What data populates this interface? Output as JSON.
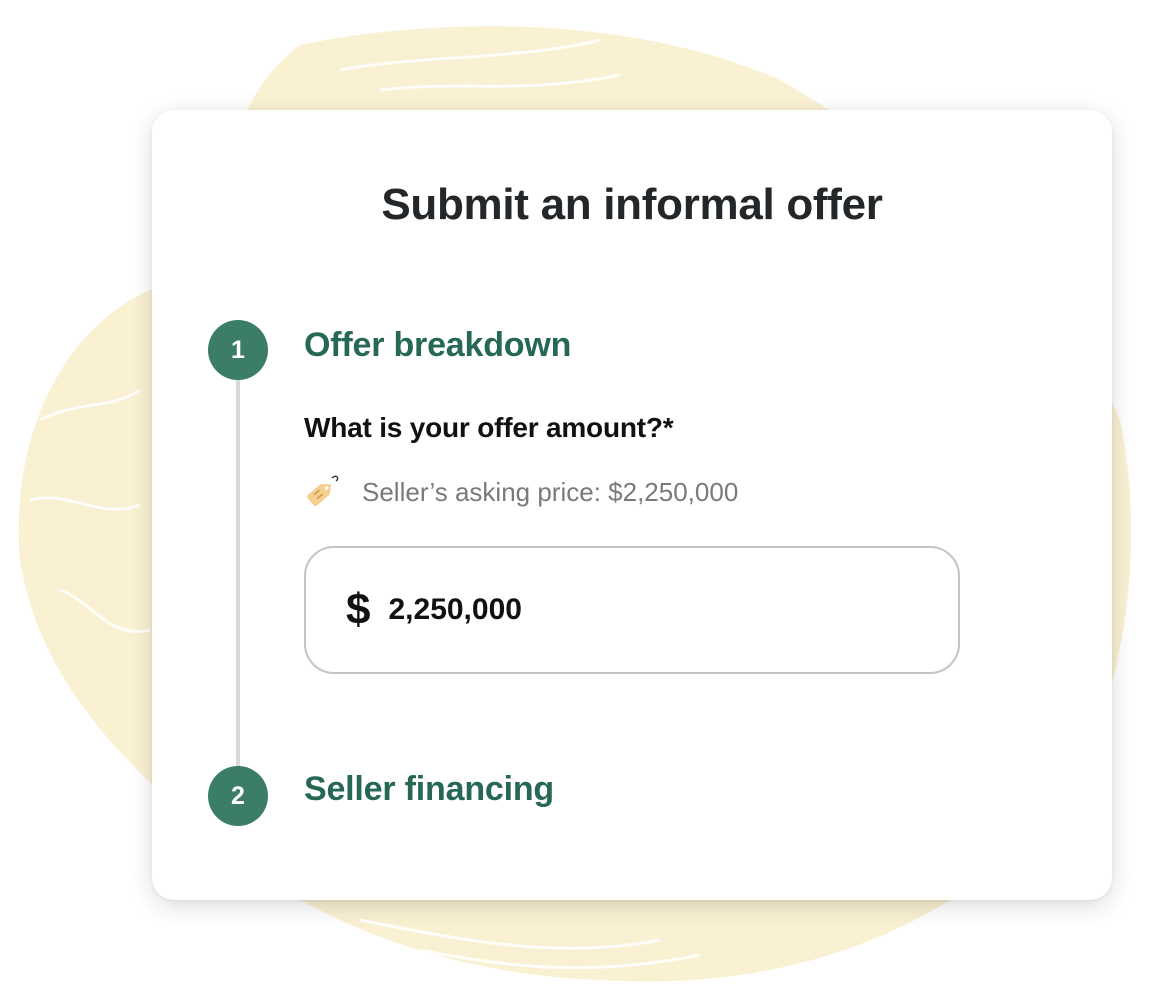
{
  "title": "Submit an informal offer",
  "steps": [
    {
      "number": "1",
      "title": "Offer breakdown"
    },
    {
      "number": "2",
      "title": "Seller financing"
    }
  ],
  "offer": {
    "question": "What is your offer amount?*",
    "asking_price_hint": "Seller’s asking price: $2,250,000",
    "currency_symbol": "$",
    "amount_value": "2,250,000"
  },
  "colors": {
    "accent_green": "#3b7d66",
    "step_title_green": "#266756",
    "brush_cream": "#faf0d2",
    "price_tag": "#f4cf8e"
  },
  "icons": {
    "hint_icon": "price-tag-icon"
  }
}
